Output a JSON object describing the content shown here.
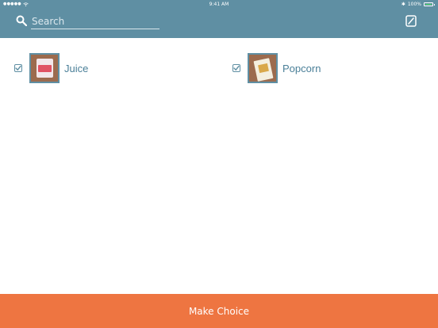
{
  "status_bar": {
    "signal": "●●●●●",
    "time": "9:41 AM",
    "battery": "100%",
    "bluetooth": "✱"
  },
  "search": {
    "placeholder": "Search",
    "value": ""
  },
  "icons": {
    "search": "search-icon",
    "edit": "edit-icon",
    "checkbox": "checkmark-icon"
  },
  "items": [
    {
      "label": "Juice",
      "checked": true
    },
    {
      "label": "Popcorn",
      "checked": true
    }
  ],
  "footer": {
    "button_label": "Make Choice"
  },
  "colors": {
    "header": "#5f8fa3",
    "accent_button": "#ee7541",
    "label_text": "#4a7f98",
    "battery": "#4cd964"
  }
}
